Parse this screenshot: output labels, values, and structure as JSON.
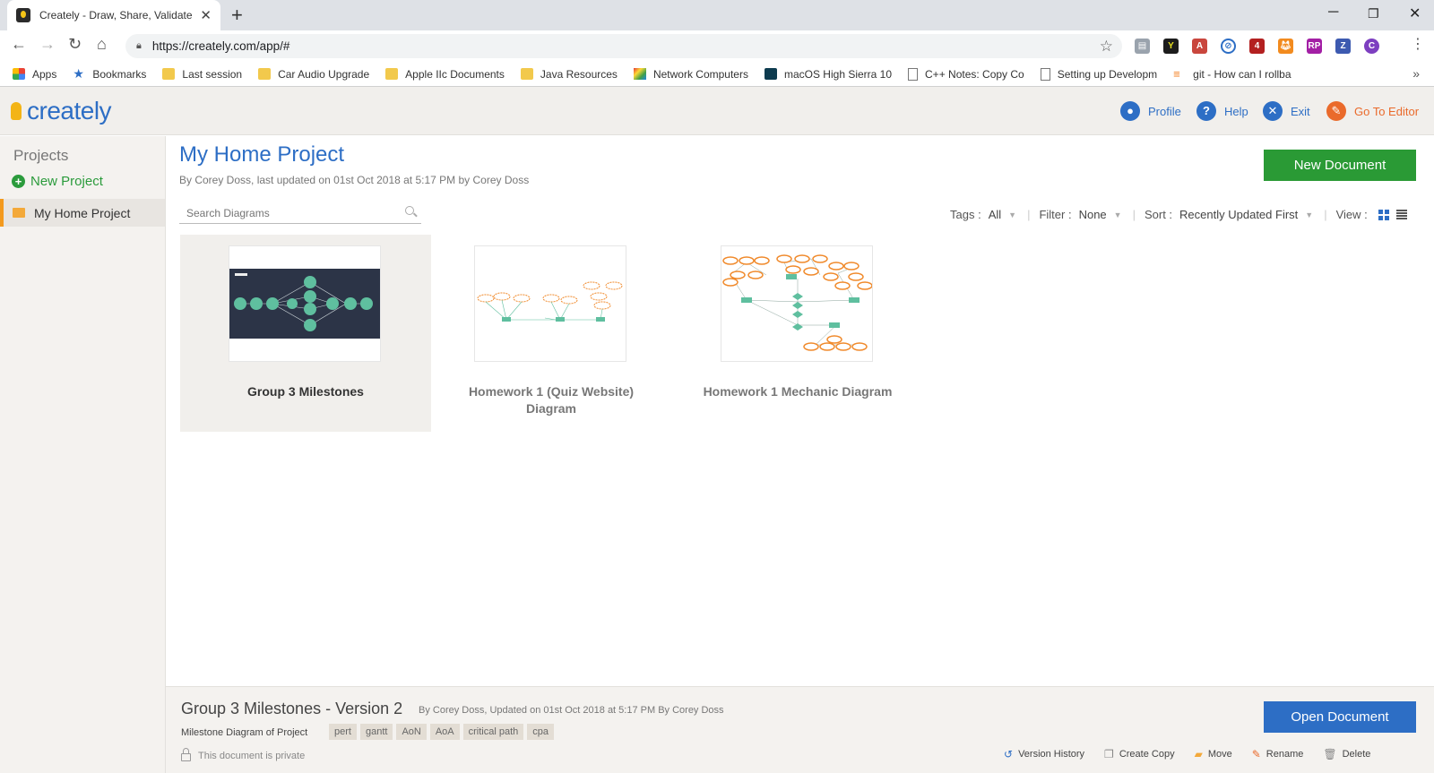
{
  "browser": {
    "tab_title": "Creately - Draw, Share, Validate a",
    "url": "https://creately.com/app/#",
    "bookmarks": [
      {
        "label": "Apps",
        "icon": "apps-grid-icon"
      },
      {
        "label": "Bookmarks",
        "icon": "star-icon"
      },
      {
        "label": "Last session",
        "icon": "folder-icon"
      },
      {
        "label": "Car Audio Upgrade",
        "icon": "folder-icon"
      },
      {
        "label": "Apple IIc Documents",
        "icon": "folder-icon"
      },
      {
        "label": "Java Resources",
        "icon": "folder-icon"
      },
      {
        "label": "Network Computers",
        "icon": "multicolor-icon"
      },
      {
        "label": "macOS High Sierra 10",
        "icon": "mac-icon"
      },
      {
        "label": "C++ Notes: Copy Co",
        "icon": "page-icon"
      },
      {
        "label": "Setting up Developm",
        "icon": "page-icon"
      },
      {
        "label": "git - How can I rollba",
        "icon": "stackoverflow-icon"
      }
    ],
    "profile_initial": "C"
  },
  "header": {
    "logo": "creately",
    "nav": {
      "profile": "Profile",
      "help": "Help",
      "exit": "Exit",
      "editor": "Go To Editor"
    }
  },
  "sidebar": {
    "title": "Projects",
    "new_project": "New Project",
    "projects": [
      {
        "label": "My Home Project",
        "selected": true
      }
    ]
  },
  "main": {
    "title": "My Home Project",
    "subtitle": "By Corey Doss, last updated on 01st Oct 2018 at 5:17 PM by Corey Doss",
    "new_document": "New Document",
    "search_placeholder": "Search Diagrams",
    "filters": {
      "tags_label": "Tags :",
      "tags_value": "All",
      "filter_label": "Filter :",
      "filter_value": "None",
      "sort_label": "Sort :",
      "sort_value": "Recently Updated First",
      "view_label": "View :"
    },
    "documents": [
      {
        "name": "Group 3 Milestones",
        "selected": true
      },
      {
        "name": "Homework 1 (Quiz Website) Diagram",
        "selected": false
      },
      {
        "name": "Homework 1 Mechanic Diagram",
        "selected": false
      }
    ]
  },
  "details": {
    "title": "Group 3 Milestones - Version 2",
    "meta": "By Corey Doss, Updated on 01st Oct 2018 at 5:17 PM By Corey Doss",
    "description": "Milestone Diagram of Project",
    "tags": [
      "pert",
      "gantt",
      "AoN",
      "AoA",
      "critical path",
      "cpa"
    ],
    "privacy": "This document is private",
    "open_document": "Open Document",
    "actions": {
      "version_history": "Version History",
      "create_copy": "Create Copy",
      "move": "Move",
      "rename": "Rename",
      "delete": "Delete"
    }
  },
  "colors": {
    "brand_blue": "#2d6ec5",
    "brand_orange": "#f39a1e",
    "green": "#2a9a35",
    "teal": "#5fbf9f",
    "dark_slide": "#2c3447"
  }
}
